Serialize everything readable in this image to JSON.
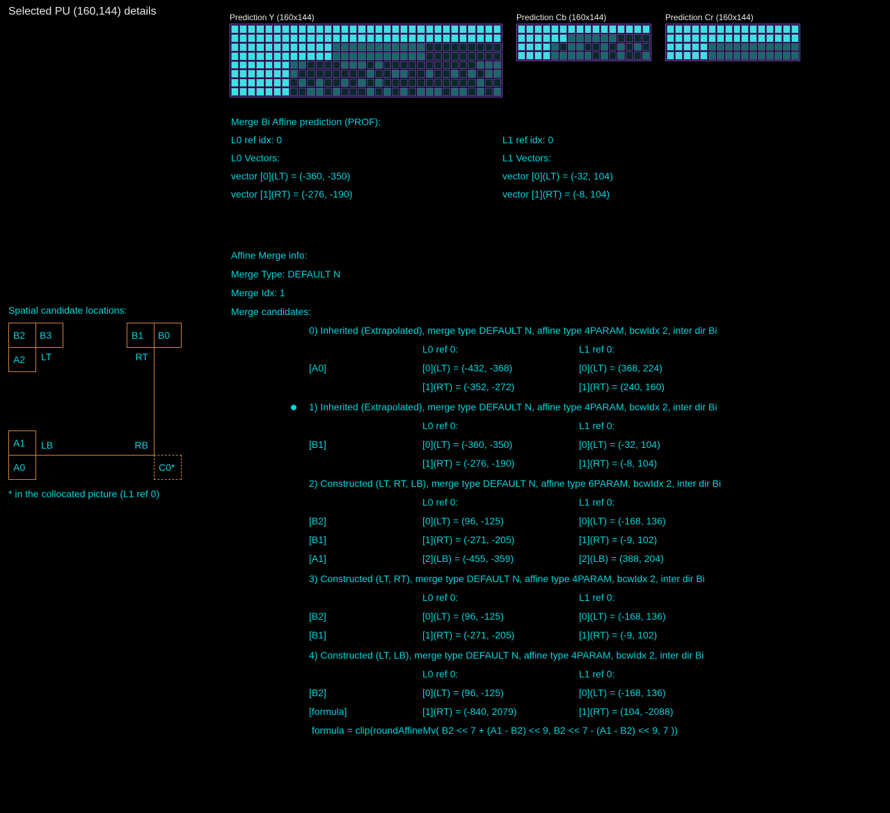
{
  "header": {
    "title": "Selected PU (160,144) details"
  },
  "predictions": {
    "y": {
      "label": "Prediction Y (160x144)"
    },
    "cb": {
      "label": "Prediction Cb (160x144)"
    },
    "cr": {
      "label": "Prediction Cr (160x144)"
    }
  },
  "info": {
    "title": "Merge Bi Affine prediction (PROF):",
    "l0_ref": "L0 ref idx: 0",
    "l1_ref": "L1 ref idx: 0",
    "l0_vec": "L0 Vectors:",
    "l1_vec": "L1 Vectors:",
    "l0_v0": "vector [0](LT) = (-360, -350)",
    "l0_v1": "vector [1](RT) = (-276, -190)",
    "l1_v0": "vector [0](LT) = (-32, 104)",
    "l1_v1": "vector [1](RT) = (-8, 104)"
  },
  "spatial": {
    "title": "Spatial candidate locations:",
    "note": "* in the collocated picture (L1 ref 0)",
    "labels": {
      "B2": "B2",
      "B3": "B3",
      "B1": "B1",
      "B0": "B0",
      "A2": "A2",
      "LT": "LT",
      "RT": "RT",
      "A1": "A1",
      "LB": "LB",
      "RB": "RB",
      "A0": "A0",
      "C0": "C0*"
    }
  },
  "merge": {
    "title": "Affine Merge info:",
    "type": "Merge Type: DEFAULT N",
    "idx": "Merge Idx: 1",
    "cand_title": "Merge candidates:",
    "candidates": [
      {
        "header": "0) Inherited (Extrapolated),  merge type DEFAULT N, affine type 4PARAM, bcwIdx 2, inter dir Bi",
        "selected": false,
        "l0ref": "L0 ref 0:",
        "l1ref": "L1 ref 0:",
        "rows": [
          {
            "src": "[A0]",
            "v0": "[0](LT) = (-432, -368)",
            "v1": "[0](LT) = (368, 224)"
          },
          {
            "src": "",
            "v0": "[1](RT) = (-352, -272)",
            "v1": "[1](RT) = (240, 160)"
          }
        ]
      },
      {
        "header": "1) Inherited (Extrapolated),  merge type DEFAULT N, affine type 4PARAM, bcwIdx 2, inter dir Bi",
        "selected": true,
        "l0ref": "L0 ref 0:",
        "l1ref": "L1 ref 0:",
        "rows": [
          {
            "src": "[B1]",
            "v0": "[0](LT) = (-360, -350)",
            "v1": "[0](LT) = (-32, 104)"
          },
          {
            "src": "",
            "v0": "[1](RT) = (-276, -190)",
            "v1": "[1](RT) = (-8, 104)"
          }
        ]
      },
      {
        "header": "2) Constructed (LT, RT, LB),  merge type DEFAULT N, affine type 6PARAM, bcwIdx 2, inter dir Bi",
        "selected": false,
        "l0ref": "L0 ref 0:",
        "l1ref": "L1 ref 0:",
        "rows": [
          {
            "src": "[B2]",
            "v0": "[0](LT) = (96, -125)",
            "v1": "[0](LT) = (-168, 136)"
          },
          {
            "src": "[B1]",
            "v0": "[1](RT) = (-271, -205)",
            "v1": "[1](RT) = (-9, 102)"
          },
          {
            "src": "[A1]",
            "v0": "[2](LB) = (-455, -359)",
            "v1": "[2](LB) = (388, 204)"
          }
        ]
      },
      {
        "header": "3) Constructed (LT, RT),  merge type DEFAULT N, affine type 4PARAM, bcwIdx 2, inter dir Bi",
        "selected": false,
        "l0ref": "L0 ref 0:",
        "l1ref": "L1 ref 0:",
        "rows": [
          {
            "src": "[B2]",
            "v0": "[0](LT) = (96, -125)",
            "v1": "[0](LT) = (-168, 136)"
          },
          {
            "src": "[B1]",
            "v0": "[1](RT) = (-271, -205)",
            "v1": "[1](RT) = (-9, 102)"
          }
        ]
      },
      {
        "header": "4) Constructed (LT, LB),  merge type DEFAULT N, affine type 4PARAM, bcwIdx 2, inter dir Bi",
        "selected": false,
        "l0ref": "L0 ref 0:",
        "l1ref": "L1 ref 0:",
        "rows": [
          {
            "src": "[B2]",
            "v0": "[0](LT) = (96, -125)",
            "v1": "[0](LT) = (-168, 136)"
          },
          {
            "src": "[formula]",
            "v0": "[1](RT) = (-840, 2079)",
            "v1": "[1](RT) = (104, -2088)"
          }
        ],
        "formula": "formula = clip(roundAffineMv( B2 << 7 + (A1 - B2) << 9, B2 << 7 - (A1 - B2) << 9, 7 ))"
      }
    ]
  },
  "pixelColors": {
    "bright": "#3ee0e0",
    "mid": "#1a6868",
    "dark": "#0a2828"
  }
}
